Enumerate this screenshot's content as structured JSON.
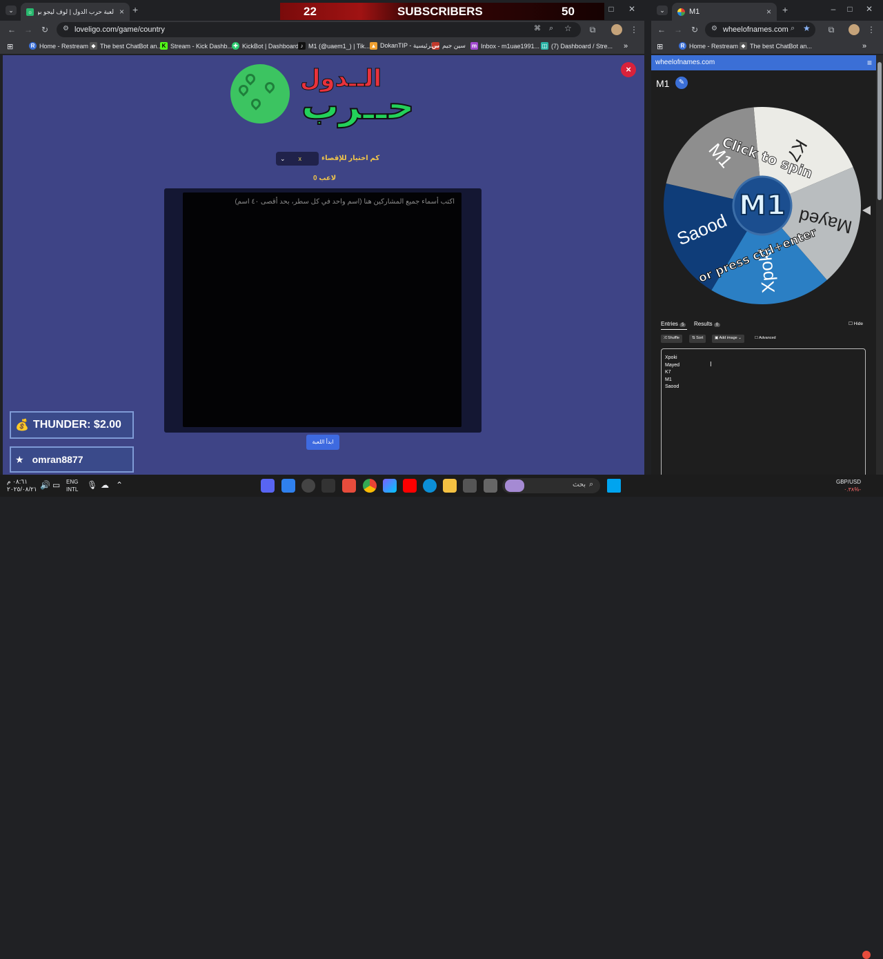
{
  "left_browser": {
    "tab_title": "لعبة حرب الدول | لوف ليجو بوفر",
    "url": "loveligo.com/game/country",
    "bookmarks": [
      "Home - Restream",
      "The best ChatBot an...",
      "Stream - Kick Dashb...",
      "KickBot | Dashboard",
      "M1 (@uaem1_) | Tik...",
      "DokanTIP - الرئيسية",
      "سين جيم",
      "Inbox - m1uae1991...",
      "(7) Dashboard / Stre..."
    ]
  },
  "subscribers": {
    "current": "22",
    "label": "SUBSCRIBERS",
    "goal": "50"
  },
  "game": {
    "logo_top": "الــدول",
    "logo_bottom": "حــرب",
    "close": "×",
    "elimination_label": "كم اختيار للإقصاء",
    "elimination_value": "x",
    "players_count": "0 لاعب",
    "names_placeholder": "اكتب أسماء جميع المشاركين هنا (اسم واحد في كل سطر، بحد أقصى ٤٠ اسم)",
    "start_button": "ابدأ اللعبة"
  },
  "overlay": {
    "donation": "THUNDER: $2.00",
    "follower": "omran8877"
  },
  "right_browser": {
    "tab_title": "M1",
    "url": "wheelofnames.com",
    "bookmarks": [
      "Home - Restream",
      "The best ChatBot an..."
    ],
    "site_header": "wheelofnames.com",
    "wheel_title": "M1",
    "wheel_center": "M1",
    "wheel_text_1": "Click to spin",
    "wheel_text_2": "or press ctrl+enter",
    "segments": [
      {
        "name": "K7",
        "color": "#ebebe6"
      },
      {
        "name": "Mayed",
        "color": "#b9bdbf"
      },
      {
        "name": "Xpoki",
        "color": "#2b7fc4"
      },
      {
        "name": "Saood",
        "color": "#0f3d79"
      },
      {
        "name": "M1",
        "color": "#8e8e8e"
      }
    ],
    "tabs": {
      "entries": "Entries",
      "entries_count": "5",
      "results": "Results",
      "results_count": "0"
    },
    "hide": "Hide",
    "buttons": {
      "shuffle": "Shuffle",
      "sort": "Sort",
      "add_image": "Add image",
      "advanced": "Advanced"
    },
    "entries": [
      "Xpoki",
      "Mayed",
      "K7",
      "M1",
      "Saood"
    ]
  },
  "taskbar": {
    "time": "٠٨:٦١ م",
    "date": "٢٠٢٥/٠٨/٢١",
    "lang_1": "ENG",
    "lang_2": "INTL",
    "search_placeholder": "بحث",
    "currency": "GBP/USD",
    "currency_change": "٠.٣٨%-"
  }
}
